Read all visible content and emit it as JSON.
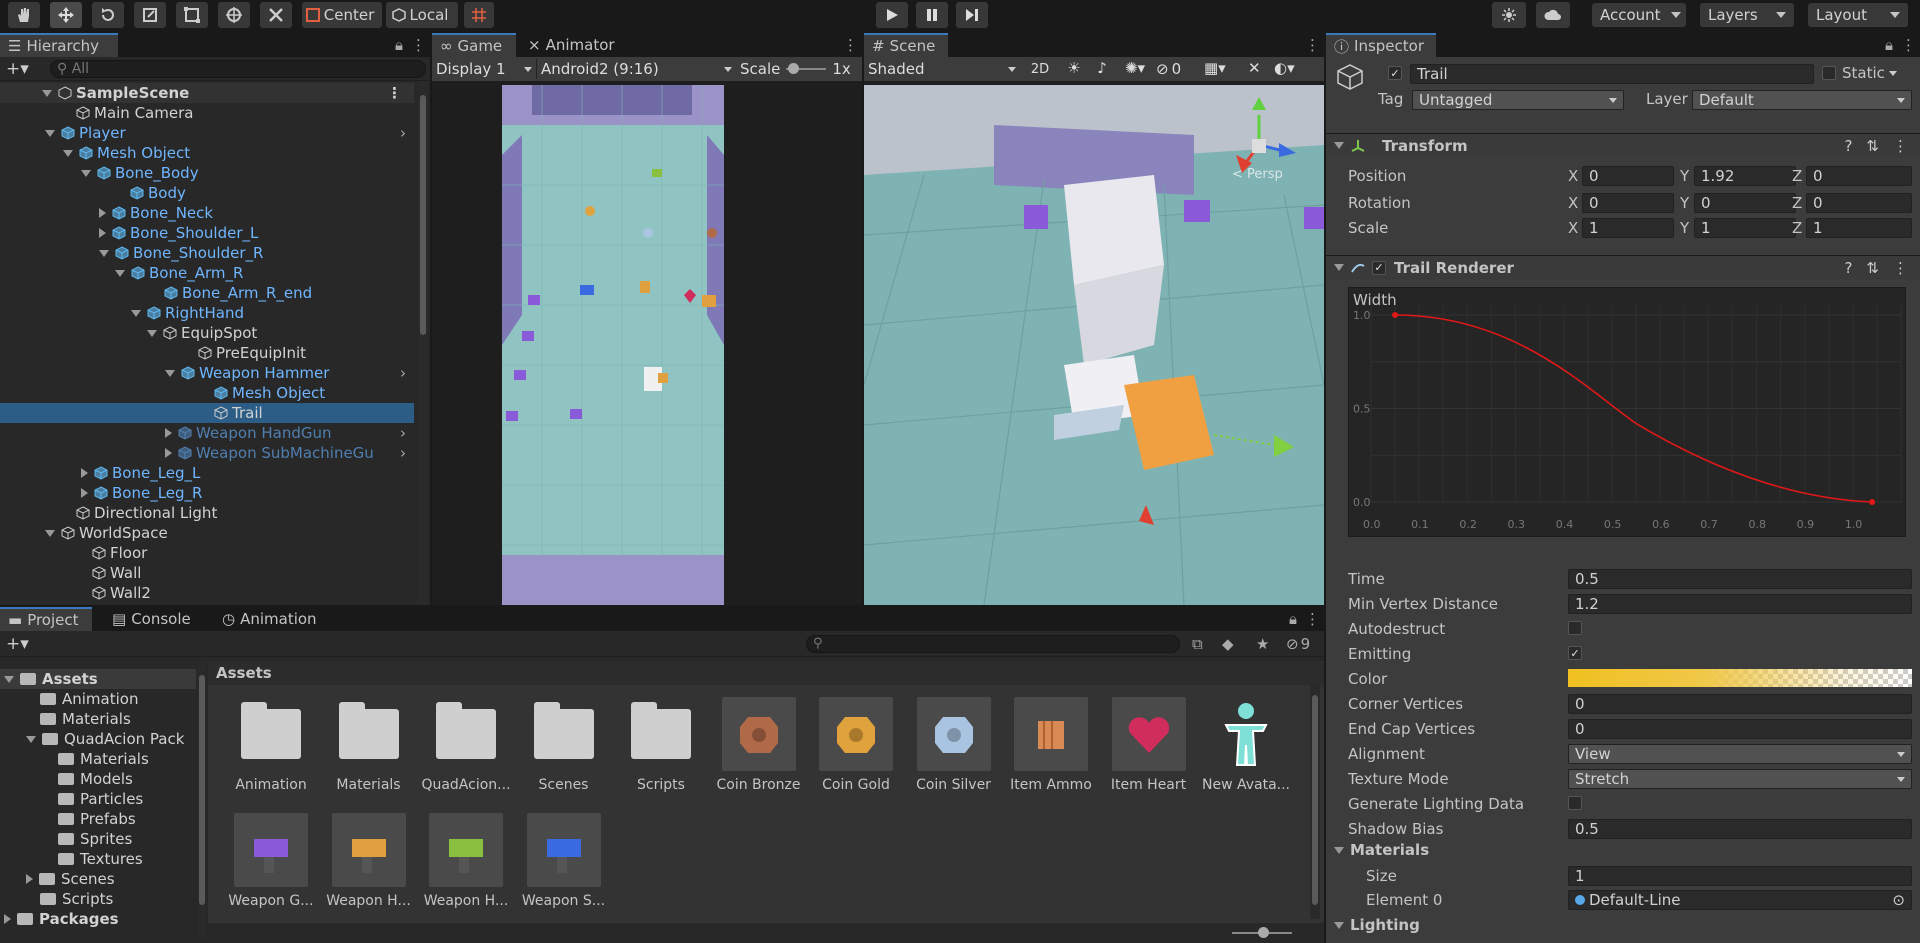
{
  "toolbar": {
    "pivot_label": "Center",
    "space_label": "Local",
    "account_label": "Account",
    "layers_label": "Layers",
    "layout_label": "Layout"
  },
  "hierarchy": {
    "tab_label": "Hierarchy",
    "search_placeholder": "All",
    "items": [
      {
        "label": "SampleScene"
      },
      {
        "label": "Main Camera"
      },
      {
        "label": "Player"
      },
      {
        "label": "Mesh Object"
      },
      {
        "label": "Bone_Body"
      },
      {
        "label": "Body"
      },
      {
        "label": "Bone_Neck"
      },
      {
        "label": "Bone_Shoulder_L"
      },
      {
        "label": "Bone_Shoulder_R"
      },
      {
        "label": "Bone_Arm_R"
      },
      {
        "label": "Bone_Arm_R_end"
      },
      {
        "label": "RightHand"
      },
      {
        "label": "EquipSpot"
      },
      {
        "label": "PreEquipInit"
      },
      {
        "label": "Weapon Hammer"
      },
      {
        "label": "Mesh Object"
      },
      {
        "label": "Trail"
      },
      {
        "label": "Weapon HandGun"
      },
      {
        "label": "Weapon SubMachineGu"
      },
      {
        "label": "Bone_Leg_L"
      },
      {
        "label": "Bone_Leg_R"
      },
      {
        "label": "Directional Light"
      },
      {
        "label": "WorldSpace"
      },
      {
        "label": "Floor"
      },
      {
        "label": "Wall"
      },
      {
        "label": "Wall2"
      }
    ]
  },
  "game": {
    "tab_label": "Game",
    "animator_tab_label": "Animator",
    "display": "Display 1",
    "resolution": "Android2 (9:16)",
    "scale_label": "Scale",
    "scale_value": "1x"
  },
  "scene": {
    "tab_label": "Scene",
    "shading": "Shaded",
    "mode_2d": "2D",
    "hidden_count": "0",
    "persp_label": "< Persp"
  },
  "inspector": {
    "tab_label": "Inspector",
    "object_name": "Trail",
    "static_label": "Static",
    "tag_label": "Tag",
    "tag_value": "Untagged",
    "layer_label": "Layer",
    "layer_value": "Default",
    "transform": {
      "title": "Transform",
      "position": {
        "label": "Position",
        "x": "0",
        "y": "1.92",
        "z": "0"
      },
      "rotation": {
        "label": "Rotation",
        "x": "0",
        "y": "0",
        "z": "0"
      },
      "scale": {
        "label": "Scale",
        "x": "1",
        "y": "1",
        "z": "1"
      },
      "axis_x": "X",
      "axis_y": "Y",
      "axis_z": "Z"
    },
    "trail_renderer": {
      "title": "Trail Renderer",
      "width_label": "Width",
      "curve_y_ticks": [
        "1.0",
        "0.5",
        "0.0"
      ],
      "curve_x_ticks": [
        "0.0",
        "0.1",
        "0.2",
        "0.3",
        "0.4",
        "0.5",
        "0.6",
        "0.7",
        "0.8",
        "0.9",
        "1.0"
      ],
      "curve_points": [
        [
          0.05,
          1.0
        ],
        [
          0.3,
          0.8
        ],
        [
          0.55,
          0.42
        ],
        [
          0.8,
          0.12
        ],
        [
          1.04,
          0.0
        ]
      ],
      "props": [
        {
          "label": "Time",
          "value": "0.5"
        },
        {
          "label": "Min Vertex Distance",
          "value": "1.2"
        },
        {
          "label": "Autodestruct",
          "value": ""
        },
        {
          "label": "Emitting",
          "value": "✓"
        },
        {
          "label": "Color",
          "value": ""
        },
        {
          "label": "Corner Vertices",
          "value": "0"
        },
        {
          "label": "End Cap Vertices",
          "value": "0"
        },
        {
          "label": "Alignment",
          "value": "View"
        },
        {
          "label": "Texture Mode",
          "value": "Stretch"
        },
        {
          "label": "Generate Lighting Data",
          "value": ""
        },
        {
          "label": "Shadow Bias",
          "value": "0.5"
        }
      ],
      "materials_label": "Materials",
      "size_label": "Size",
      "size_value": "1",
      "element0_label": "Element 0",
      "element0_value": "Default-Line",
      "lighting_label": "Lighting"
    }
  },
  "project": {
    "tab_project": "Project",
    "tab_console": "Console",
    "tab_animation": "Animation",
    "search_count": "9",
    "breadcrumb": "Assets",
    "tree": [
      {
        "label": "Assets"
      },
      {
        "label": "Animation"
      },
      {
        "label": "Materials"
      },
      {
        "label": "QuadAcion Pack"
      },
      {
        "label": "Materials"
      },
      {
        "label": "Models"
      },
      {
        "label": "Particles"
      },
      {
        "label": "Prefabs"
      },
      {
        "label": "Sprites"
      },
      {
        "label": "Textures"
      },
      {
        "label": "Scenes"
      },
      {
        "label": "Scripts"
      },
      {
        "label": "Packages"
      }
    ],
    "assets": [
      {
        "label": "Animation",
        "kind": "folder"
      },
      {
        "label": "Materials",
        "kind": "folder"
      },
      {
        "label": "QuadAcion...",
        "kind": "folder"
      },
      {
        "label": "Scenes",
        "kind": "folder"
      },
      {
        "label": "Scripts",
        "kind": "folder"
      },
      {
        "label": "Coin Bronze",
        "kind": "coin",
        "color": "#b06a48"
      },
      {
        "label": "Coin Gold",
        "kind": "coin",
        "color": "#e0a23c"
      },
      {
        "label": "Coin Silver",
        "kind": "coin",
        "color": "#a9c4e0"
      },
      {
        "label": "Item Ammo",
        "kind": "ammo",
        "color": "#d88a54"
      },
      {
        "label": "Item Heart",
        "kind": "heart",
        "color": "#d02c5c"
      },
      {
        "label": "New Avata...",
        "kind": "avatar",
        "color": "#7fe0d8"
      },
      {
        "label": "Weapon G...",
        "kind": "weapon",
        "color": "#8a5ad8"
      },
      {
        "label": "Weapon H...",
        "kind": "weapon",
        "color": "#e0a040"
      },
      {
        "label": "Weapon H...",
        "kind": "weapon",
        "color": "#8ac040"
      },
      {
        "label": "Weapon S...",
        "kind": "weapon",
        "color": "#3a6ae0"
      }
    ]
  }
}
